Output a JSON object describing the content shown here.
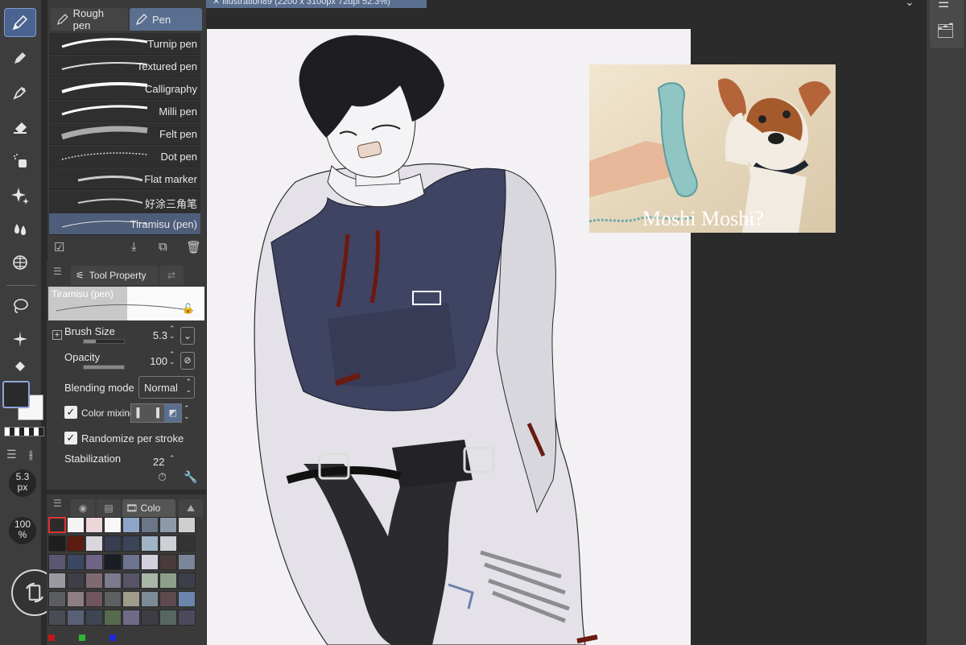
{
  "document": {
    "tab_title": "illustration89 (2200 x 3100px 72dpi 52.3%)"
  },
  "toolbar": {
    "tools": [
      "pen-icon",
      "pencil-icon",
      "marker-icon",
      "eraser-icon",
      "airbrush-icon",
      "decoration-icon",
      "blend-icon",
      "figure-icon",
      "lasso-icon",
      "auto-select-icon",
      "fill-icon"
    ],
    "brush_size_readout": "5.3",
    "brush_size_unit": "px",
    "opacity_readout": "100",
    "opacity_unit": "%"
  },
  "subtool": {
    "tabs": [
      {
        "label": "Rough pen"
      },
      {
        "label": "Pen"
      }
    ],
    "brushes": [
      {
        "label": "Turnip pen"
      },
      {
        "label": "Textured pen"
      },
      {
        "label": "Calligraphy"
      },
      {
        "label": "Milli pen"
      },
      {
        "label": "Felt pen"
      },
      {
        "label": "Dot pen"
      },
      {
        "label": "Flat marker"
      },
      {
        "label": "好涂三角笔"
      },
      {
        "label": "Tiramisu (pen)"
      }
    ]
  },
  "tool_property": {
    "tab_label": "Tool Property",
    "preview_label": "Tiramisu (pen)",
    "brush_size_label": "Brush Size",
    "brush_size_value": "5.3",
    "brush_size_fill": 0.3,
    "opacity_label": "Opacity",
    "opacity_value": "100",
    "opacity_fill": 1.0,
    "blending_label": "Blending mode",
    "blending_value": "Normal",
    "color_mixing_label": "Color mixing",
    "randomize_label": "Randomize per stroke",
    "stabilization_label": "Stabilization",
    "stabilization_value": "22"
  },
  "colorset": {
    "tab_label": "Colo",
    "swatches": [
      "#2b2b2b",
      "#f4f4f4",
      "#ecd6d8",
      "#f7f7f7",
      "#8fa6c9",
      "#6b7688",
      "#8e9aa8",
      "#cfcfcf",
      "#1e1e1e",
      "#5c1c10",
      "#d9d6de",
      "#3a3c52",
      "#3c4458",
      "#9fb5c7",
      "#cdd1d6",
      "#333333",
      "#5d5672",
      "#3b4862",
      "#6d6486",
      "#1a1d24",
      "#6c7490",
      "#d4d0e0",
      "#4a3c3c",
      "#7c869a",
      "#9a9aa0",
      "#3f3f4a",
      "#806a72",
      "#7c7a8e",
      "#565466",
      "#a9b7a6",
      "#8e9f8a",
      "#3c3f4a",
      "#5b5d62",
      "#8c7e82",
      "#6f555c",
      "#5d6060",
      "#9f9c8a",
      "#7d8b98",
      "#5e4a4e",
      "#6c85ad",
      "#4a4c55",
      "#586076",
      "#3d4652",
      "#566b4e",
      "#6f6a86",
      "#3e3c44",
      "#586662",
      "#4b4a5c"
    ]
  },
  "reference": {
    "caption": "Moshi Moshi?"
  }
}
